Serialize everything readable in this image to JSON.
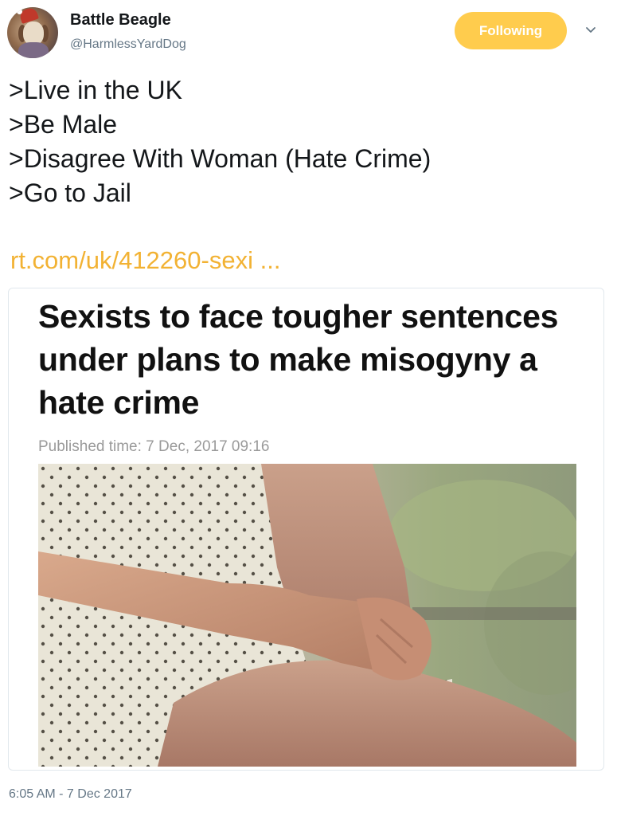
{
  "user": {
    "display_name": "Battle Beagle",
    "handle": "@HarmlessYardDog",
    "avatar_icon": "santa-hat-dog-avatar"
  },
  "follow_button": {
    "label": "Following",
    "color": "#ffcc4d"
  },
  "menu_icon": "chevron-down-icon",
  "tweet": {
    "lines": [
      ">Live in the UK",
      ">Be Male",
      ">Disagree With Woman (Hate Crime)",
      ">Go to Jail"
    ],
    "link": "rt.com/uk/412260-sexi ...",
    "link_color": "#f2b233",
    "timestamp": "6:05 AM - 7 Dec 2017"
  },
  "card": {
    "headline": "Sexists to face tougher sentences under plans to make misogyny a hate crime",
    "published": "Published time: 7 Dec, 2017 09:16",
    "image": "woman-polka-dot-dress-clasped-hands-photo"
  }
}
